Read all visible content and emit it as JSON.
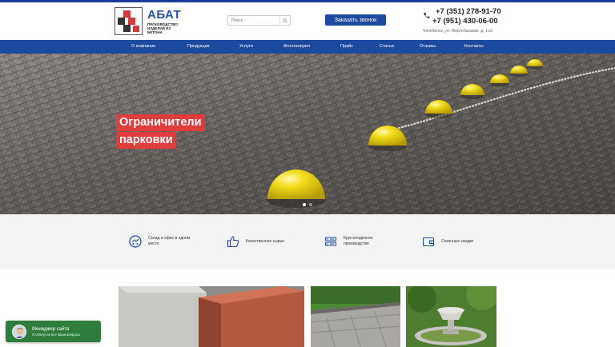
{
  "header": {
    "logo_title": "АБАТ",
    "logo_subtitle_1": "ПРОИЗВОДСТВО",
    "logo_subtitle_2": "ИЗДЕЛИЙ ИЗ БЕТОНА",
    "search_placeholder": "Поиск...",
    "call_button": "Заказать звонок",
    "phone_1": "+7 (351) 278-91-70",
    "phone_2": "+7 (951) 430-06-00",
    "address": "Челябинск, ул. Нефтебазовая, д. 1,к3"
  },
  "nav": {
    "items": [
      "О компании",
      "Продукция",
      "Услуги",
      "Фотогалерея",
      "Прайс",
      "Статьи",
      "Отзывы",
      "Контакты"
    ]
  },
  "hero": {
    "title_line_1": "Ограничители",
    "title_line_2": "парковки",
    "slides_total": 2,
    "active_slide": 1
  },
  "features": [
    {
      "label": "Склад и офис в одном месте",
      "icon": "delivery-icon"
    },
    {
      "label": "Качественное сырье",
      "icon": "thumbs-up-icon"
    },
    {
      "label": "Круглогодичное производство",
      "icon": "production-icon"
    },
    {
      "label": "Сезонные скидки",
      "icon": "wallet-icon"
    }
  ],
  "chat": {
    "title": "Менеджер сайта",
    "subtitle": "Я отвечу на все ваши вопросы"
  },
  "colors": {
    "brand_blue": "#1c4a9e",
    "accent_red": "#e03c3c",
    "chat_green": "#2f7d3e",
    "bollard_yellow": "#f2dc1a"
  }
}
